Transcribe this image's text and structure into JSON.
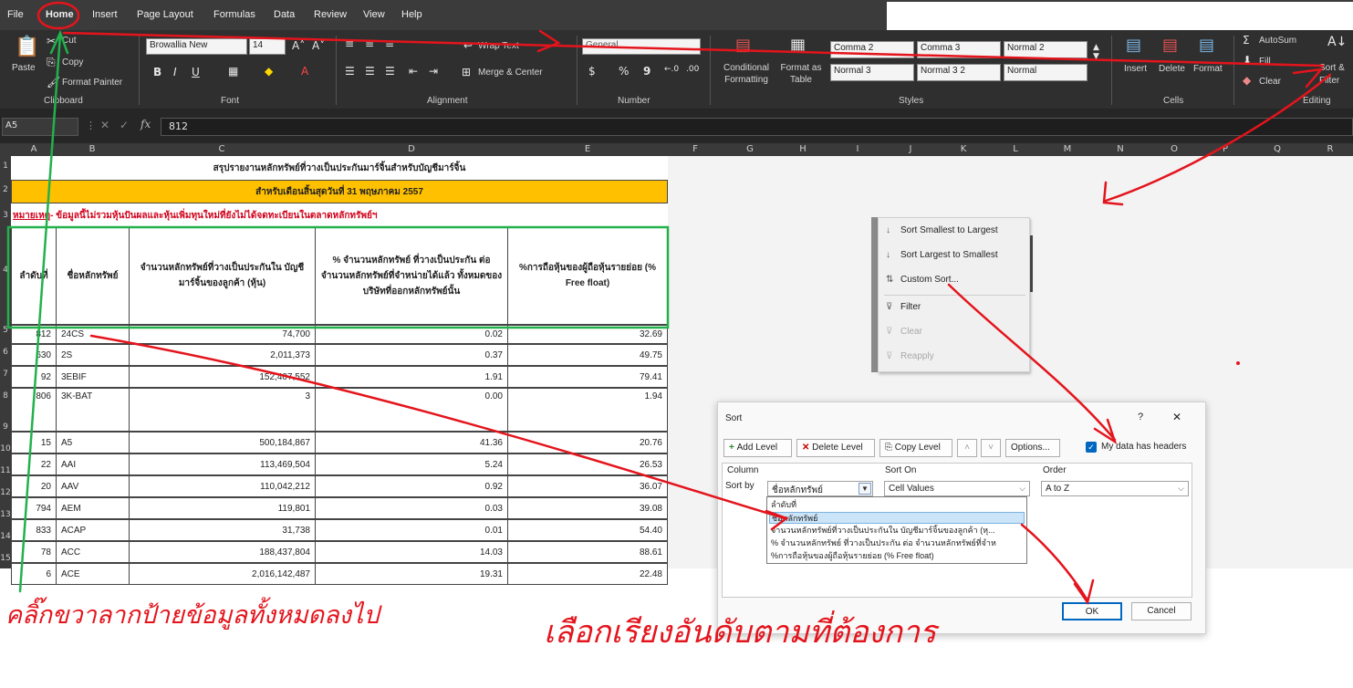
{
  "menu": {
    "tabs": [
      "File",
      "Home",
      "Insert",
      "Page Layout",
      "Formulas",
      "Data",
      "Review",
      "View",
      "Help"
    ]
  },
  "ribbon": {
    "clipboard": {
      "paste": "Paste",
      "cut": "Cut",
      "copy": "Copy",
      "format_painter": "Format Painter",
      "group": "Clipboard"
    },
    "font": {
      "font_name": "Browallia New",
      "font_size": "14",
      "group": "Font"
    },
    "alignment": {
      "wrap_text": "Wrap Text",
      "merge_center": "Merge & Center",
      "group": "Alignment"
    },
    "number": {
      "format": "General",
      "currency": "$",
      "percent": "%",
      "comma": "9",
      "group": "Number"
    },
    "styles": {
      "conditional_formatting": "Conditional Formatting",
      "format_as_table": "Format as Table",
      "cells": [
        "Comma 2",
        "Comma 3",
        "Normal 2",
        "Normal 3",
        "Normal 3 2",
        "Normal"
      ],
      "group": "Styles"
    },
    "cells": {
      "insert": "Insert",
      "delete": "Delete",
      "format": "Format",
      "group": "Cells"
    },
    "editing": {
      "autosum": "AutoSum",
      "fill": "Fill",
      "clear": "Clear",
      "sort_filter": "Sort & Filter",
      "group": "Editing"
    }
  },
  "formula_bar": {
    "name_box": "A5",
    "value": "812"
  },
  "columns": [
    "A",
    "B",
    "C",
    "D",
    "E",
    "F",
    "G",
    "H",
    "I",
    "J",
    "K",
    "L",
    "M",
    "N",
    "O",
    "P",
    "Q",
    "R"
  ],
  "sheet": {
    "title": "สรุปรายงานหลักทรัพย์ที่วางเป็นประกันมาร์จิ้นสำหรับบัญชีมาร์จิ้น",
    "subtitle": "สำหรับเดือนสิ้นสุดวันที่ 31 พฤษภาคม 2557",
    "note_label": "หมายเหตุ",
    "note_text": " - ข้อมูลนี้ไม่รวมหุ้นปันผลและหุ้นเพิ่มทุนใหม่ที่ยังไม่ได้จดทะเบียนในตลาดหลักทรัพย์ฯ",
    "headers": [
      "ลำดับที่",
      "ชื่อหลักทรัพย์",
      "จำนวนหลักทรัพย์ที่วางเป็นประกันใน บัญชีมาร์จิ้นของลูกค้า (หุ้น)",
      "% จำนวนหลักทรัพย์ ที่วางเป็นประกัน ต่อ จำนวนหลักทรัพย์ที่จำหน่ายได้แล้ว ทั้งหมดของบริษัทที่ออกหลักทรัพย์นั้น",
      "%การถือหุ้นของผู้ถือหุ้นรายย่อย (% Free float)"
    ],
    "rows": [
      [
        "812",
        "24CS",
        "74,700",
        "0.02",
        "32.69"
      ],
      [
        "630",
        "2S",
        "2,011,373",
        "0.37",
        "49.75"
      ],
      [
        "92",
        "3EBIF",
        "152,407,552",
        "1.91",
        "79.41"
      ],
      [
        "806",
        "3K-BAT",
        "3",
        "0.00",
        "1.94"
      ],
      [
        "15",
        "A5",
        "500,184,867",
        "41.36",
        "20.76"
      ],
      [
        "22",
        "AAI",
        "113,469,504",
        "5.24",
        "26.53"
      ],
      [
        "20",
        "AAV",
        "110,042,212",
        "0.92",
        "36.07"
      ],
      [
        "794",
        "AEM",
        "119,801",
        "0.03",
        "39.08"
      ],
      [
        "833",
        "ACAP",
        "31,738",
        "0.01",
        "54.40"
      ],
      [
        "78",
        "ACC",
        "188,437,804",
        "14.03",
        "88.61"
      ],
      [
        "6",
        "ACE",
        "2,016,142,487",
        "19.31",
        "22.48"
      ]
    ],
    "row_numbers": [
      "1",
      "2",
      "3",
      "4",
      "5",
      "6",
      "7",
      "8",
      "9",
      "10",
      "11",
      "12",
      "13",
      "14",
      "15"
    ]
  },
  "context_menu": {
    "items": [
      "Sort Smallest to Largest",
      "Sort Largest to Smallest",
      "Custom Sort...",
      "Filter",
      "Clear",
      "Reapply"
    ]
  },
  "sort_dialog": {
    "title": "Sort",
    "help": "?",
    "close": "✕",
    "add_level": "Add Level",
    "delete_level": "Delete Level",
    "copy_level": "Copy Level",
    "options": "Options...",
    "my_data_has_headers": "My data has headers",
    "col_header": "Column",
    "sort_on_header": "Sort On",
    "order_header": "Order",
    "sort_by": "Sort by",
    "column_value": "ชื่อหลักทรัพย์",
    "sort_on_value": "Cell Values",
    "order_value": "A to Z",
    "dropdown_options": [
      "ลำดับที่",
      "ชื่อหลักทรัพย์",
      "จำนวนหลักทรัพย์ที่วางเป็นประกันใน บัญชีมาร์จิ้นของลูกค้า (หุ...",
      "% จำนวนหลักทรัพย์ ที่วางเป็นประกัน ต่อ จำนวนหลักทรัพย์ที่จำห",
      "%การถือหุ้นของผู้ถือหุ้นรายย่อย (% Free float)"
    ],
    "ok": "OK",
    "cancel": "Cancel"
  },
  "annotations": {
    "caption_left": "คลิ๊กขวาลากป้ายข้อมูลทั้งหมดลงไป",
    "caption_right": "เลือกเรียงอันดับตามที่ต้องการ",
    "arrow_color": "#e4141c",
    "green_color": "#22b14c"
  }
}
